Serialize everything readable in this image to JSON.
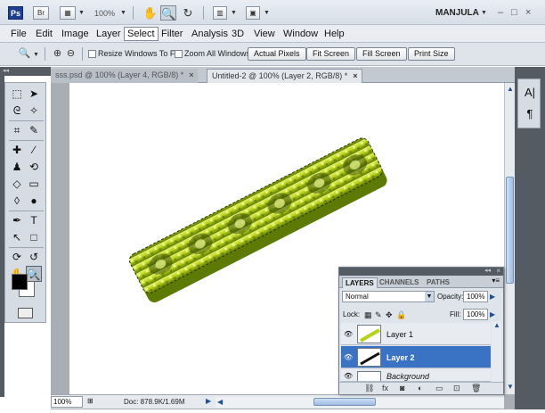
{
  "appbar": {
    "logo": "Ps",
    "bridge_label": "Br",
    "zoom": "100%",
    "workspace": "MANJULA",
    "window_controls": [
      "–",
      "□",
      "×"
    ]
  },
  "menu": {
    "items": [
      "File",
      "Edit",
      "Image",
      "Layer",
      "Select",
      "Filter",
      "Analysis",
      "3D",
      "View",
      "Window",
      "Help"
    ],
    "active": "Select"
  },
  "options": {
    "resize_label": "Resize Windows To Fit",
    "zoom_all_label": "Zoom All Windows",
    "buttons": [
      "Actual Pixels",
      "Fit Screen",
      "Fill Screen",
      "Print Size"
    ]
  },
  "tabs": [
    {
      "title": "sss.psd @ 100% (Layer 4, RGB/8) *",
      "active": false
    },
    {
      "title": "Untitled-2 @ 100% (Layer 2, RGB/8) *",
      "active": true
    }
  ],
  "status": {
    "zoom": "100%",
    "doc": "Doc: 878.9K/1.69M"
  },
  "layers_panel": {
    "tabs": [
      "LAYERS",
      "CHANNELS",
      "PATHS"
    ],
    "blend_mode": "Normal",
    "opacity_label": "Opacity:",
    "opacity_value": "100%",
    "lock_label": "Lock:",
    "fill_label": "Fill:",
    "fill_value": "100%",
    "layers": [
      {
        "name": "Layer 1",
        "selected": false
      },
      {
        "name": "Layer 2",
        "selected": true
      },
      {
        "name": "Background",
        "selected": false
      }
    ]
  },
  "colors": {
    "selection": "#3b73c4",
    "text_fill": "#b8d11a",
    "text_dark": "#5d7a05"
  }
}
